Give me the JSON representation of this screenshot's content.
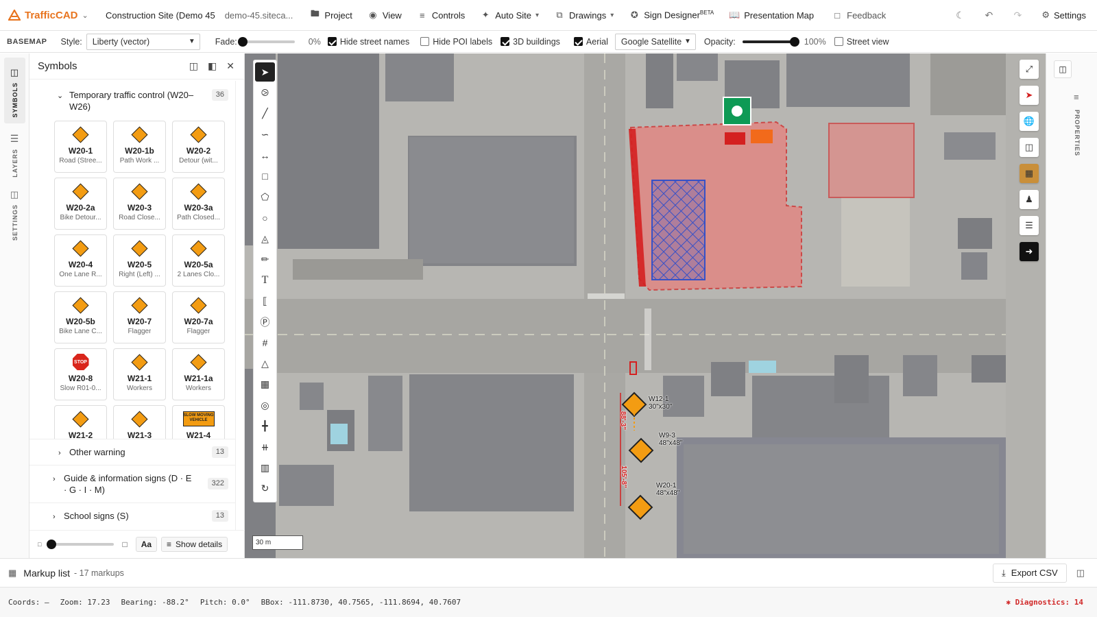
{
  "topbar": {
    "app_name": "TrafficCAD",
    "site_name": "Construction Site (Demo 45",
    "site_sub": "demo-45.siteca...",
    "menus": {
      "project": "Project",
      "view": "View",
      "controls": "Controls",
      "auto_site": "Auto Site",
      "drawings": "Drawings",
      "sign_designer": "Sign Designer",
      "sign_designer_badge": "BETA",
      "presentation_map": "Presentation Map",
      "feedback": "Feedback",
      "settings": "Settings"
    }
  },
  "basemap": {
    "label": "BASEMAP",
    "style_label": "Style:",
    "style_value": "Liberty (vector)",
    "fade_label": "Fade:",
    "fade_value": "0%",
    "fade_level": 0,
    "hide_street_names": "Hide street names",
    "hide_poi_labels": "Hide POI labels",
    "buildings_3d": "3D buildings",
    "aerial": "Aerial",
    "aerial_source": "Google Satellite",
    "opacity_label": "Opacity:",
    "opacity_value": "100%",
    "opacity_level": 1,
    "street_view": "Street view"
  },
  "left_rail": {
    "symbols": "SYMBOLS",
    "layers": "LAYERS",
    "settings": "SETTINGS"
  },
  "symbols_panel": {
    "title": "Symbols",
    "group": {
      "label": "Temporary traffic control (W20–W26)",
      "count": "36"
    },
    "signs": [
      {
        "code": "W20-1",
        "desc": "Road (Stree..."
      },
      {
        "code": "W20-1b",
        "desc": "Path Work ..."
      },
      {
        "code": "W20-2",
        "desc": "Detour (wit..."
      },
      {
        "code": "W20-2a",
        "desc": "Bike Detour..."
      },
      {
        "code": "W20-3",
        "desc": "Road Close..."
      },
      {
        "code": "W20-3a",
        "desc": "Path Closed..."
      },
      {
        "code": "W20-4",
        "desc": "One Lane R..."
      },
      {
        "code": "W20-5",
        "desc": "Right (Left) ..."
      },
      {
        "code": "W20-5a",
        "desc": "2 Lanes Clo..."
      },
      {
        "code": "W20-5b",
        "desc": "Bike Lane C..."
      },
      {
        "code": "W20-7",
        "desc": "Flagger"
      },
      {
        "code": "W20-7a",
        "desc": "Flagger"
      },
      {
        "code": "W20-8",
        "desc": "Slow R01-0..."
      },
      {
        "code": "W21-1",
        "desc": "Workers"
      },
      {
        "code": "W21-1a",
        "desc": "Workers"
      },
      {
        "code": "W21-2",
        "desc": ""
      },
      {
        "code": "W21-3",
        "desc": ""
      },
      {
        "code": "W21-4",
        "desc": ""
      }
    ],
    "stop_text": "STOP",
    "slow_text": "SLOW MOVING VEHICLE",
    "other_groups": [
      {
        "label": "Other warning",
        "count": "13"
      },
      {
        "label": "Guide & information signs (D · E · G · I · M)",
        "count": "322"
      },
      {
        "label": "School signs (S)",
        "count": "13"
      }
    ],
    "footer": {
      "size_level": 0.05,
      "font_button": "Aa",
      "show_details": "Show details"
    }
  },
  "map": {
    "scale_label": "30 m",
    "dim_labels": [
      "88'-3\"",
      "105'-8\""
    ],
    "sign_labels": [
      {
        "code": "W12-1",
        "size": "30\"x30\""
      },
      {
        "code": "W9-3",
        "size": "48\"x48\""
      },
      {
        "code": "W20-1",
        "size": "48\"x48\""
      }
    ]
  },
  "right_rail": {
    "properties": "PROPERTIES"
  },
  "markup_list": {
    "title": "Markup list",
    "count_text": "- 17 markups",
    "export": "Export CSV"
  },
  "status": {
    "coords": "Coords: —",
    "zoom": "Zoom: 17.23",
    "bearing": "Bearing: -88.2°",
    "pitch": "Pitch: 0.0°",
    "bbox": "BBox: -111.8730, 40.7565, -111.8694, 40.7607",
    "diagnostics": "Diagnostics: 14"
  },
  "colors": {
    "brand": "#e8741e",
    "zone_fill": "#e8807c",
    "zone_stroke": "#d42020",
    "hatch": "#2f4ec9",
    "sign": "#f39c12"
  }
}
